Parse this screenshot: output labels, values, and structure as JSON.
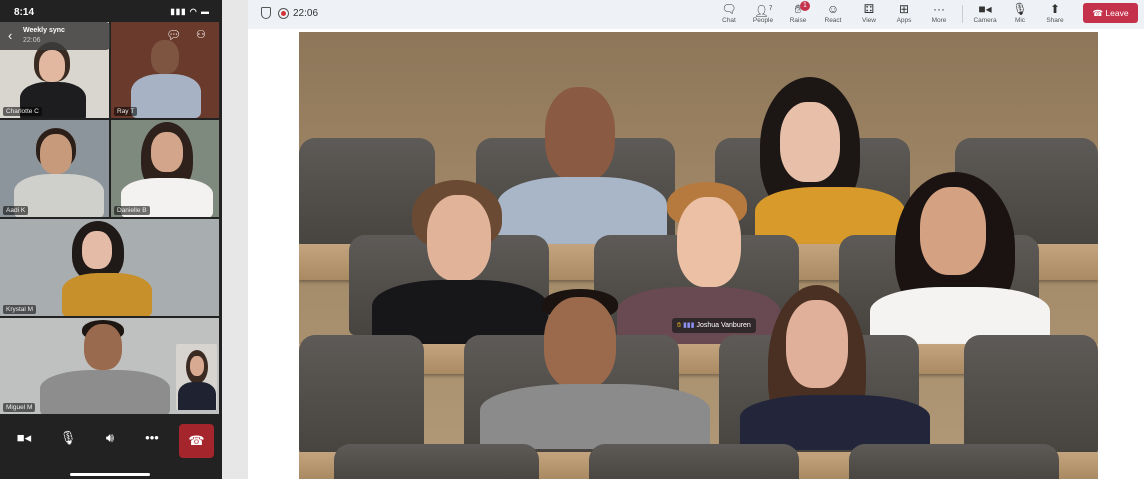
{
  "phone": {
    "status_time": "8:14",
    "meeting_title": "Weekly sync",
    "meeting_timer": "22:06",
    "participants": [
      {
        "name": "Charlotte C"
      },
      {
        "name": "Ray T"
      },
      {
        "name": "Aadi K"
      },
      {
        "name": "Danielle B"
      },
      {
        "name": "Krystal M"
      },
      {
        "name": "Miguel M"
      }
    ],
    "controls": [
      "camera-icon",
      "mic-icon",
      "speaker-icon",
      "more-icon",
      "hang-up-icon"
    ]
  },
  "desktop": {
    "timer": "22:06",
    "toolbar": [
      {
        "label": "Chat",
        "icon": "chat-icon"
      },
      {
        "label": "People",
        "icon": "people-icon",
        "count": "7"
      },
      {
        "label": "Raise",
        "icon": "raise-hand-icon",
        "badge": "1"
      },
      {
        "label": "React",
        "icon": "react-icon"
      },
      {
        "label": "View",
        "icon": "view-icon"
      },
      {
        "label": "Apps",
        "icon": "apps-icon"
      },
      {
        "label": "More",
        "icon": "more-icon"
      },
      {
        "label": "Camera",
        "icon": "camera-icon"
      },
      {
        "label": "Mic",
        "icon": "mic-icon"
      },
      {
        "label": "Share",
        "icon": "share-icon"
      }
    ],
    "leave_label": "Leave",
    "speaker_name": "Joshua Vanburen",
    "colors": {
      "leave": "#c4314b",
      "record": "#d13438"
    }
  }
}
